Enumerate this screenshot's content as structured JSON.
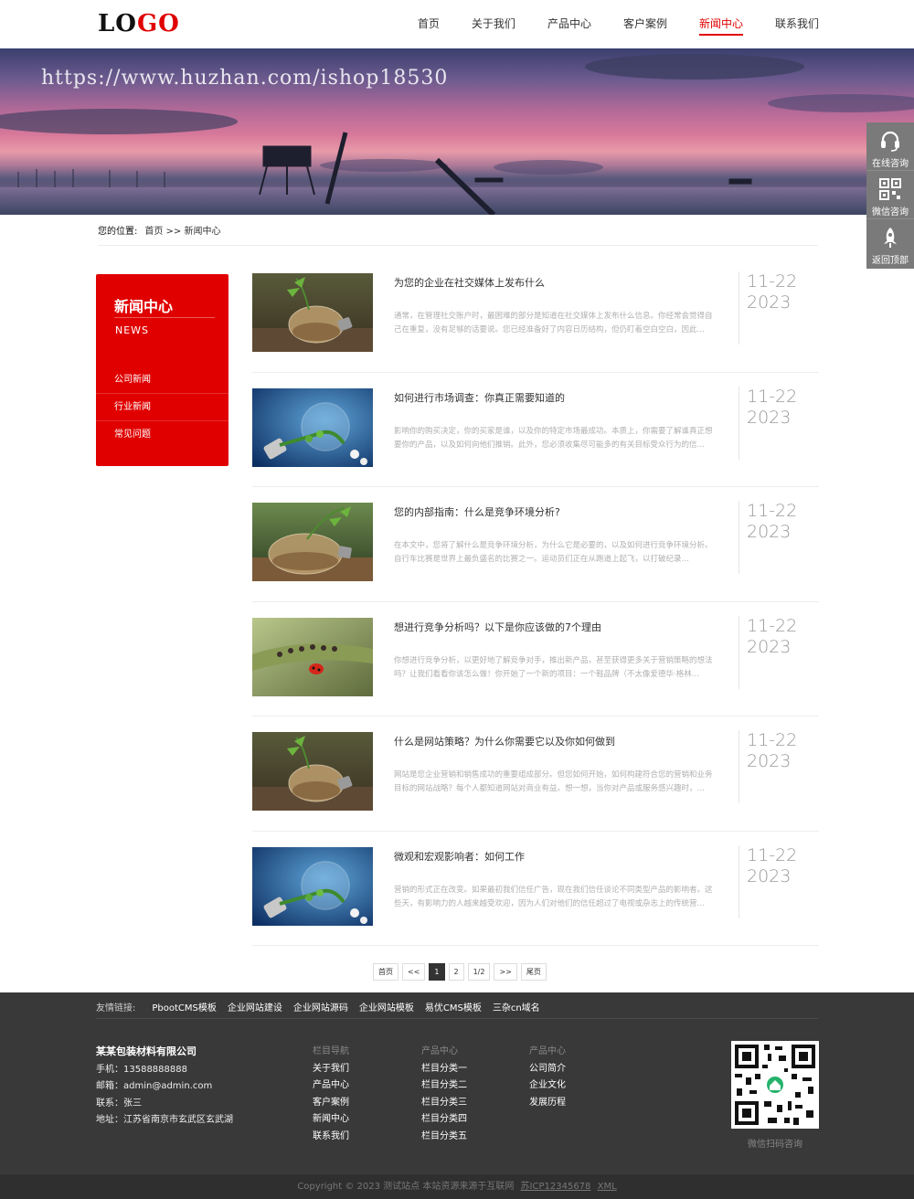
{
  "header": {
    "logo_left": "LO",
    "logo_right": "GO",
    "nav": [
      "首页",
      "关于我们",
      "产品中心",
      "客户案例",
      "新闻中心",
      "联系我们"
    ],
    "active_index": 4
  },
  "banner": {
    "watermark": "https://www.huzhan.com/ishop18530"
  },
  "float": {
    "items": [
      {
        "label": "在线咨询",
        "icon": "headset-icon"
      },
      {
        "label": "微信咨询",
        "icon": "qrcode-icon"
      },
      {
        "label": "返回顶部",
        "icon": "rocket-icon"
      }
    ]
  },
  "breadcrumb": {
    "label": "您的位置:",
    "path": "首页 >> 新闻中心"
  },
  "sidebar": {
    "title": "新闻中心",
    "subtitle": "NEWS",
    "items": [
      "公司新闻",
      "行业新闻",
      "常见问题"
    ]
  },
  "news": [
    {
      "title": "为您的企业在社交媒体上发布什么",
      "desc": "通常，在管理社交账户时，最困难的部分是知道在社交媒体上发布什么信息。你经常会觉得自己在重复，没有足够的话要说。您已经准备好了内容日历结构，但仍盯着空白空白，因此…",
      "date_md": "11-22",
      "date_y": "2023",
      "thumb": "plant-bulb"
    },
    {
      "title": "如何进行市场调查：你真正需要知道的",
      "desc": "影响你的购买决定，你的买家是谁，以及你的特定市场最成功。本质上，你需要了解谁真正想要你的产品，以及如何向他们推销。此外，您必须收集尽可能多的有关目标受众行为的信…",
      "date_md": "11-22",
      "date_y": "2023",
      "thumb": "lightbulb"
    },
    {
      "title": "您的内部指南：什么是竞争环境分析?",
      "desc": "在本文中，您将了解什么是竞争环境分析，为什么它是必要的，以及如何进行竞争环境分析。自行车比赛是世界上最负盛名的比赛之一。运动员们正在从跑道上起飞，以打破纪录…",
      "date_md": "11-22",
      "date_y": "2023",
      "thumb": "plant-bulb-tilt"
    },
    {
      "title": "想进行竞争分析吗？以下是你应该做的7个理由",
      "desc": "你想进行竞争分析，以更好地了解竞争对手，推出新产品，甚至获得更多关于营销策略的想法吗？让我们看看你该怎么做！你开始了一个新的项目：一个鞋品牌（不太像爱德华·格林…",
      "date_md": "11-22",
      "date_y": "2023",
      "thumb": "ladybug"
    },
    {
      "title": "什么是网站策略？为什么你需要它以及你如何做到",
      "desc": "网站是您企业营销和销售成功的重要组成部分。但您如何开始，如何构建符合您的营销和业务目标的网站战略？每个人都知道网站对商业有益。想一想，当你对产品或服务感兴趣时，…",
      "date_md": "11-22",
      "date_y": "2023",
      "thumb": "plant-bulb"
    },
    {
      "title": "微观和宏观影响者：如何工作",
      "desc": "营销的形式正在改变。如果最初我们信任广告，现在我们信任谈论不同类型产品的影响者。这些天，有影响力的人越来越受欢迎，因为人们对他们的信任超过了电视或杂志上的传统营…",
      "date_md": "11-22",
      "date_y": "2023",
      "thumb": "lightbulb"
    }
  ],
  "pager": {
    "first": "首页",
    "prev": "<<",
    "pages": [
      "1",
      "2"
    ],
    "current": "1",
    "count": "1/2",
    "next": ">>",
    "last": "尾页"
  },
  "footer": {
    "links_label": "友情链接:",
    "links": [
      "PbootCMS模板",
      "企业网站建设",
      "企业网站源码",
      "企业网站模板",
      "易优CMS模板",
      "三杂cn域名"
    ],
    "company": {
      "name": "某某包装材料有限公司",
      "phone": "手机：13588888888",
      "email": "邮箱：admin@admin.com",
      "contact": "联系：张三",
      "address": "地址：江苏省南京市玄武区玄武湖"
    },
    "cols": [
      {
        "head": "栏目导航",
        "items": [
          "关于我们",
          "产品中心",
          "客户案例",
          "新闻中心",
          "联系我们"
        ]
      },
      {
        "head": "产品中心",
        "items": [
          "栏目分类一",
          "栏目分类二",
          "栏目分类三",
          "栏目分类四",
          "栏目分类五"
        ]
      },
      {
        "head": "产品中心",
        "items": [
          "公司简介",
          "企业文化",
          "发展历程"
        ]
      }
    ],
    "qr_caption": "微信扫码咨询",
    "copyright": "Copyright © 2023 测试站点 本站资源来源于互联网",
    "icp": "苏ICP12345678",
    "xml": "XML"
  },
  "colors": {
    "accent": "#e00000",
    "footer_bg": "#393939"
  }
}
